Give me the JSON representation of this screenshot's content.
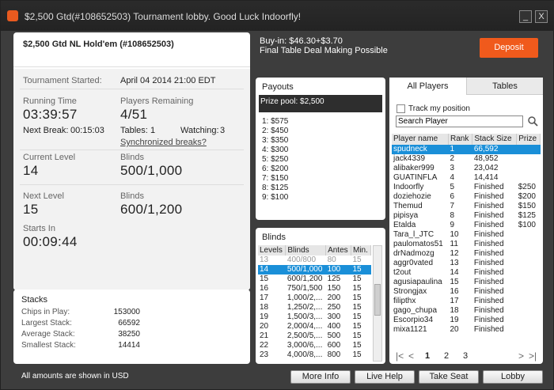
{
  "window": {
    "title": "$2,500 Gtd(#108652503) Tournament lobby. Good Luck Indoorfly!",
    "min": "_",
    "close": "X"
  },
  "tournament": {
    "name": "$2,500 Gtd NL Hold'em (#108652503)",
    "buyin": "Buy-in: $46.30+$3.70",
    "subtitle": "Final Table Deal Making Possible",
    "deposit": "Deposit",
    "started_label": "Tournament Started:",
    "started_value": "April 04 2014   21:00 EDT",
    "running_label": "Running Time",
    "running_value": "03:39:57",
    "remaining_label": "Players Remaining",
    "remaining_value": "4/51",
    "next_break_label": "Next Break:",
    "next_break_value": "00:15:03",
    "tables_label": "Tables:",
    "tables_value": "1",
    "watching_label": "Watching:",
    "watching_value": "3",
    "sync_breaks": "Synchronized breaks?",
    "current_level_label": "Current Level",
    "current_level_value": "14",
    "blinds_label": "Blinds",
    "current_blinds_value": "500/1,000",
    "next_level_label": "Next Level",
    "next_level_value": "15",
    "next_blinds_label": "Blinds",
    "next_blinds_value": "600/1,200",
    "starts_in_label": "Starts In",
    "starts_in_value": "00:09:44"
  },
  "stacks": {
    "title": "Stacks",
    "rows": [
      {
        "label": "Chips in Play:",
        "value": "153000"
      },
      {
        "label": "Largest Stack:",
        "value": "66592"
      },
      {
        "label": "Average Stack:",
        "value": "38250"
      },
      {
        "label": "Smallest Stack:",
        "value": "14414"
      }
    ]
  },
  "currency_note": "All amounts are shown in USD",
  "payouts": {
    "title": "Payouts",
    "prize_pool": "Prize pool: $2,500",
    "rows": [
      "1: $575",
      "2: $450",
      "3: $350",
      "4: $300",
      "5: $250",
      "6: $200",
      "7: $150",
      "8: $125",
      "9: $100"
    ]
  },
  "blinds": {
    "title": "Blinds",
    "headers": [
      "Levels",
      "Blinds",
      "Antes",
      "Min."
    ],
    "rows": [
      [
        "13",
        "400/800",
        "80",
        "15"
      ],
      [
        "14",
        "500/1,000",
        "100",
        "15"
      ],
      [
        "15",
        "600/1,200",
        "125",
        "15"
      ],
      [
        "16",
        "750/1,500",
        "150",
        "15"
      ],
      [
        "17",
        "1,000/2,...",
        "200",
        "15"
      ],
      [
        "18",
        "1,250/2,...",
        "250",
        "15"
      ],
      [
        "19",
        "1,500/3,...",
        "300",
        "15"
      ],
      [
        "20",
        "2,000/4,...",
        "400",
        "15"
      ],
      [
        "21",
        "2,500/5,...",
        "500",
        "15"
      ],
      [
        "22",
        "3,000/6,...",
        "600",
        "15"
      ],
      [
        "23",
        "4,000/8,...",
        "800",
        "15"
      ]
    ]
  },
  "players": {
    "tab_all": "All Players",
    "tab_tables": "Tables",
    "track_label": "Track my position",
    "search_placeholder": "Search Player",
    "headers": [
      "Player name",
      "Rank",
      "Stack Size",
      "Prize"
    ],
    "rows": [
      [
        "spudneck",
        "1",
        "66,592",
        ""
      ],
      [
        "jack4339",
        "2",
        "48,952",
        ""
      ],
      [
        "alibaker999",
        "3",
        "23,042",
        ""
      ],
      [
        "GUATINFLA",
        "4",
        "14,414",
        ""
      ],
      [
        "Indoorfly",
        "5",
        "Finished",
        "$250"
      ],
      [
        "doziehozie",
        "6",
        "Finished",
        "$200"
      ],
      [
        "Themud",
        "7",
        "Finished",
        "$150"
      ],
      [
        "pipisya",
        "8",
        "Finished",
        "$125"
      ],
      [
        "Etalda",
        "9",
        "Finished",
        "$100"
      ],
      [
        "Tara_l_JTC",
        "10",
        "Finished",
        ""
      ],
      [
        "paulomatos51",
        "11",
        "Finished",
        ""
      ],
      [
        "drNadmozg",
        "12",
        "Finished",
        ""
      ],
      [
        "aggr0vated",
        "13",
        "Finished",
        ""
      ],
      [
        "t2out",
        "14",
        "Finished",
        ""
      ],
      [
        "agusiapaulina",
        "15",
        "Finished",
        ""
      ],
      [
        "Strongjax",
        "16",
        "Finished",
        ""
      ],
      [
        "filipthx",
        "17",
        "Finished",
        ""
      ],
      [
        "gago_chupa",
        "18",
        "Finished",
        ""
      ],
      [
        "Escorpio34",
        "19",
        "Finished",
        ""
      ],
      [
        "mixa1121",
        "20",
        "Finished",
        ""
      ]
    ],
    "pages": [
      "1",
      "2",
      "3"
    ],
    "nav_first": "|<",
    "nav_prev": "<",
    "nav_next": ">",
    "nav_last": ">|"
  },
  "buttons": {
    "more_info": "More Info",
    "live_help": "Live Help",
    "take_seat": "Take Seat",
    "lobby": "Lobby"
  },
  "colors": {
    "accent": "#f05a1c",
    "selection": "#1a8fd8",
    "window_bg": "#3d3d3d"
  }
}
